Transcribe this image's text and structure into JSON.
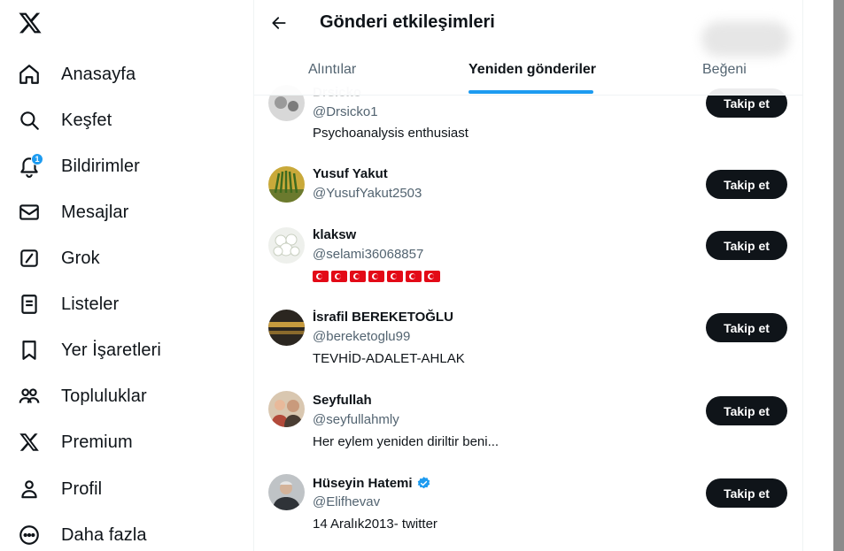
{
  "sidebar": {
    "items": [
      {
        "label": "Anasayfa",
        "icon": "home-icon"
      },
      {
        "label": "Keşfet",
        "icon": "search-icon"
      },
      {
        "label": "Bildirimler",
        "icon": "bell-icon",
        "badge": "1"
      },
      {
        "label": "Mesajlar",
        "icon": "mail-icon"
      },
      {
        "label": "Grok",
        "icon": "grok-icon"
      },
      {
        "label": "Listeler",
        "icon": "list-icon"
      },
      {
        "label": "Yer İşaretleri",
        "icon": "bookmark-icon"
      },
      {
        "label": "Topluluklar",
        "icon": "communities-icon"
      },
      {
        "label": "Premium",
        "icon": "x-premium-icon"
      },
      {
        "label": "Profil",
        "icon": "profile-icon"
      },
      {
        "label": "Daha fazla",
        "icon": "more-icon"
      }
    ]
  },
  "header": {
    "title": "Gönderi etkileşimleri",
    "tabs": [
      {
        "label": "Alıntılar"
      },
      {
        "label": "Yeniden gönderiler"
      },
      {
        "label": "Beğeni"
      }
    ]
  },
  "users": [
    {
      "name": "Drsicko",
      "handle": "@Drsicko1",
      "bio": "Psychoanalysis enthusiast",
      "follow": "Takip et"
    },
    {
      "name": "Yusuf Yakut",
      "handle": "@YusufYakut2503",
      "bio": "",
      "follow": "Takip et"
    },
    {
      "name": "klaksw",
      "handle": "@selami36068857",
      "bio": "",
      "follow": "Takip et"
    },
    {
      "name": "İsrafil BEREKETOĞLU",
      "handle": "@bereketoglu99",
      "bio": "TEVHİD-ADALET-AHLAK",
      "follow": "Takip et"
    },
    {
      "name": "Seyfullah",
      "handle": "@seyfullahmly",
      "bio": "Her eylem yeniden diriltir beni...",
      "follow": "Takip et"
    },
    {
      "name": "Hüseyin Hatemi",
      "handle": "@Elifhevav",
      "bio": "14 Aralık2013- twitter",
      "follow": "Takip et"
    }
  ],
  "colors": {
    "accent": "#1d9bf0",
    "text": "#0f1419",
    "secondary": "#536471",
    "button": "#0f1419"
  }
}
